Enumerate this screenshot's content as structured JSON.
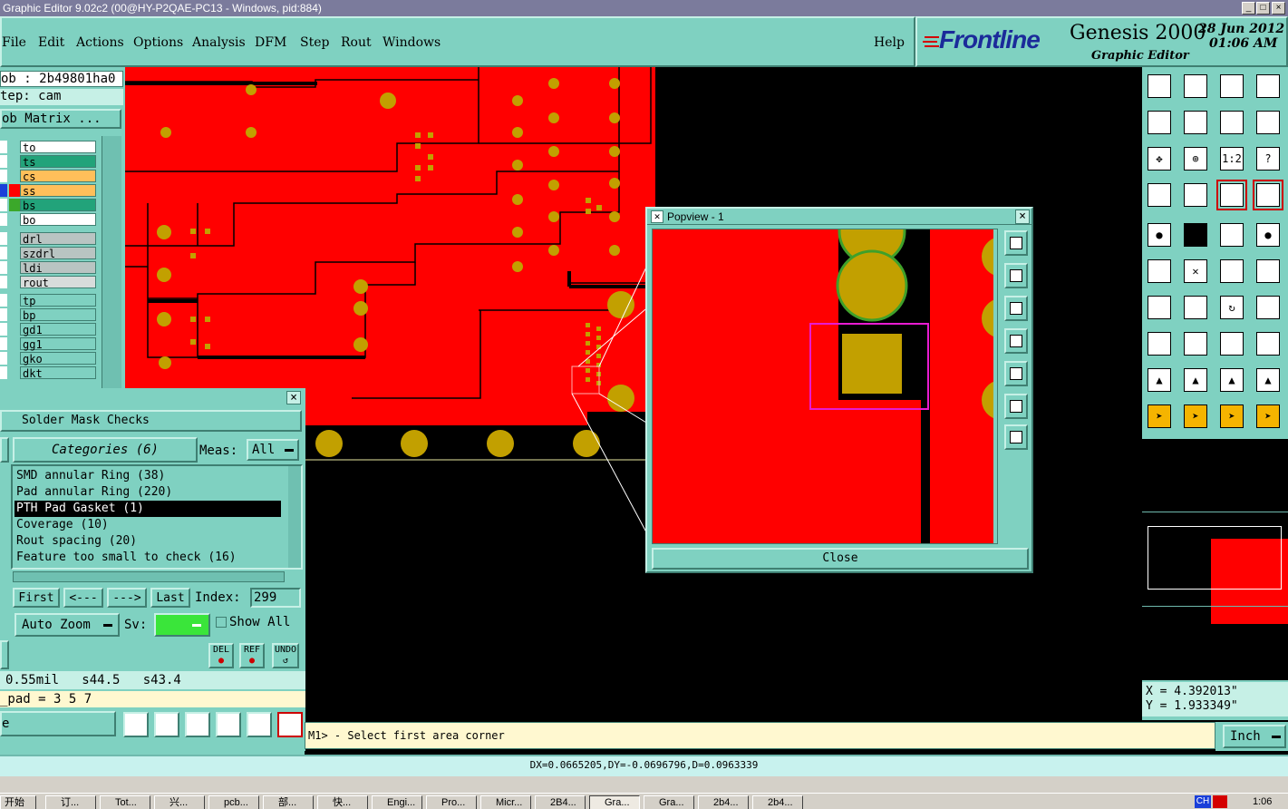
{
  "window": {
    "title": "Graphic Editor 9.02c2 (00@HY-P2QAE-PC13 - Windows, pid:884)",
    "min": "_",
    "max": "□",
    "close": "×"
  },
  "menu": {
    "items": [
      "File",
      "Edit",
      "Actions",
      "Options",
      "Analysis",
      "DFM",
      "Step",
      "Rout",
      "Windows"
    ],
    "help": "Help"
  },
  "brand": {
    "logo": "Frontline",
    "product": "Genesis 2000",
    "subtitle": "Graphic Editor",
    "date": "28 Jun 2012",
    "time": "01:06 AM"
  },
  "job": {
    "job_label": "ob : 2b49801ha0",
    "step_label": "tep: cam",
    "matrix_button": "ob Matrix ..."
  },
  "layers": {
    "board": [
      {
        "name": "to",
        "color": "#ffffff"
      },
      {
        "name": "ts",
        "color": "#22a37a"
      },
      {
        "name": "cs",
        "color": "#ffbf5a"
      },
      {
        "name": "ss",
        "color": "#ffbf5a"
      },
      {
        "name": "bs",
        "color": "#22a37a"
      },
      {
        "name": "bo",
        "color": "#ffffff"
      }
    ],
    "drill": [
      {
        "name": "drl",
        "color": "#b9c4c2"
      },
      {
        "name": "szdrl",
        "color": "#b9c4c2"
      },
      {
        "name": "ldi",
        "color": "#b9c4c2"
      },
      {
        "name": "rout",
        "color": "#d8dcdb"
      }
    ],
    "misc": [
      {
        "name": "tp"
      },
      {
        "name": "bp"
      },
      {
        "name": "gd1"
      },
      {
        "name": "gg1"
      },
      {
        "name": "gko"
      },
      {
        "name": "dkt"
      }
    ]
  },
  "popview": {
    "title": "Popview - 1",
    "close_button": "Close",
    "close_x": "×"
  },
  "solder_mask": {
    "title": "Solder Mask Checks",
    "categories_label": "Categories (6)",
    "meas_label": "Meas:",
    "meas_value": "All",
    "items": [
      "SMD annular Ring (38)",
      "Pad annular Ring (220)",
      "PTH Pad Gasket (1)",
      "Coverage (10)",
      "Rout spacing (20)",
      "Feature too small to check (16)"
    ],
    "selected_index": 2,
    "nav": {
      "first": "First",
      "prev": "<---",
      "next": "--->",
      "last": "Last"
    },
    "index_label": "Index:",
    "index_value": "299",
    "zoom_value": "Auto Zoom",
    "sv_label": "Sv:",
    "show_all_label": "Show All",
    "del_label": "DEL",
    "ref_label": "REF",
    "undo_label": "UNDO",
    "measure_text": "0.55mil   s44.5   s43.4",
    "pad_text": "_pad = 3 5 7",
    "bottom_field": "e"
  },
  "status": {
    "command": "M1> - Select first area corner",
    "units": "Inch",
    "x": "X = 4.392013\"",
    "y": "Y = 1.933349\"",
    "delta": "DX=0.0665205,DY=-0.0696796,D=0.0963339"
  },
  "taskbar": {
    "start": "开始",
    "tasks": [
      "订...",
      "Tot...",
      "兴...",
      "pcb...",
      "部...",
      "快...",
      "Engi...",
      "Pro...",
      "Micr...",
      "2B4...",
      "Gra...",
      "Gra...",
      "2b4...",
      "2b4..."
    ],
    "active_task": 10,
    "tray_lang": "CH",
    "clock": "1:06"
  },
  "colors": {
    "panel": "#7fd1c1",
    "copper": "#ff0000",
    "pad": "#c2a000",
    "highlight": "#e81bd2"
  }
}
